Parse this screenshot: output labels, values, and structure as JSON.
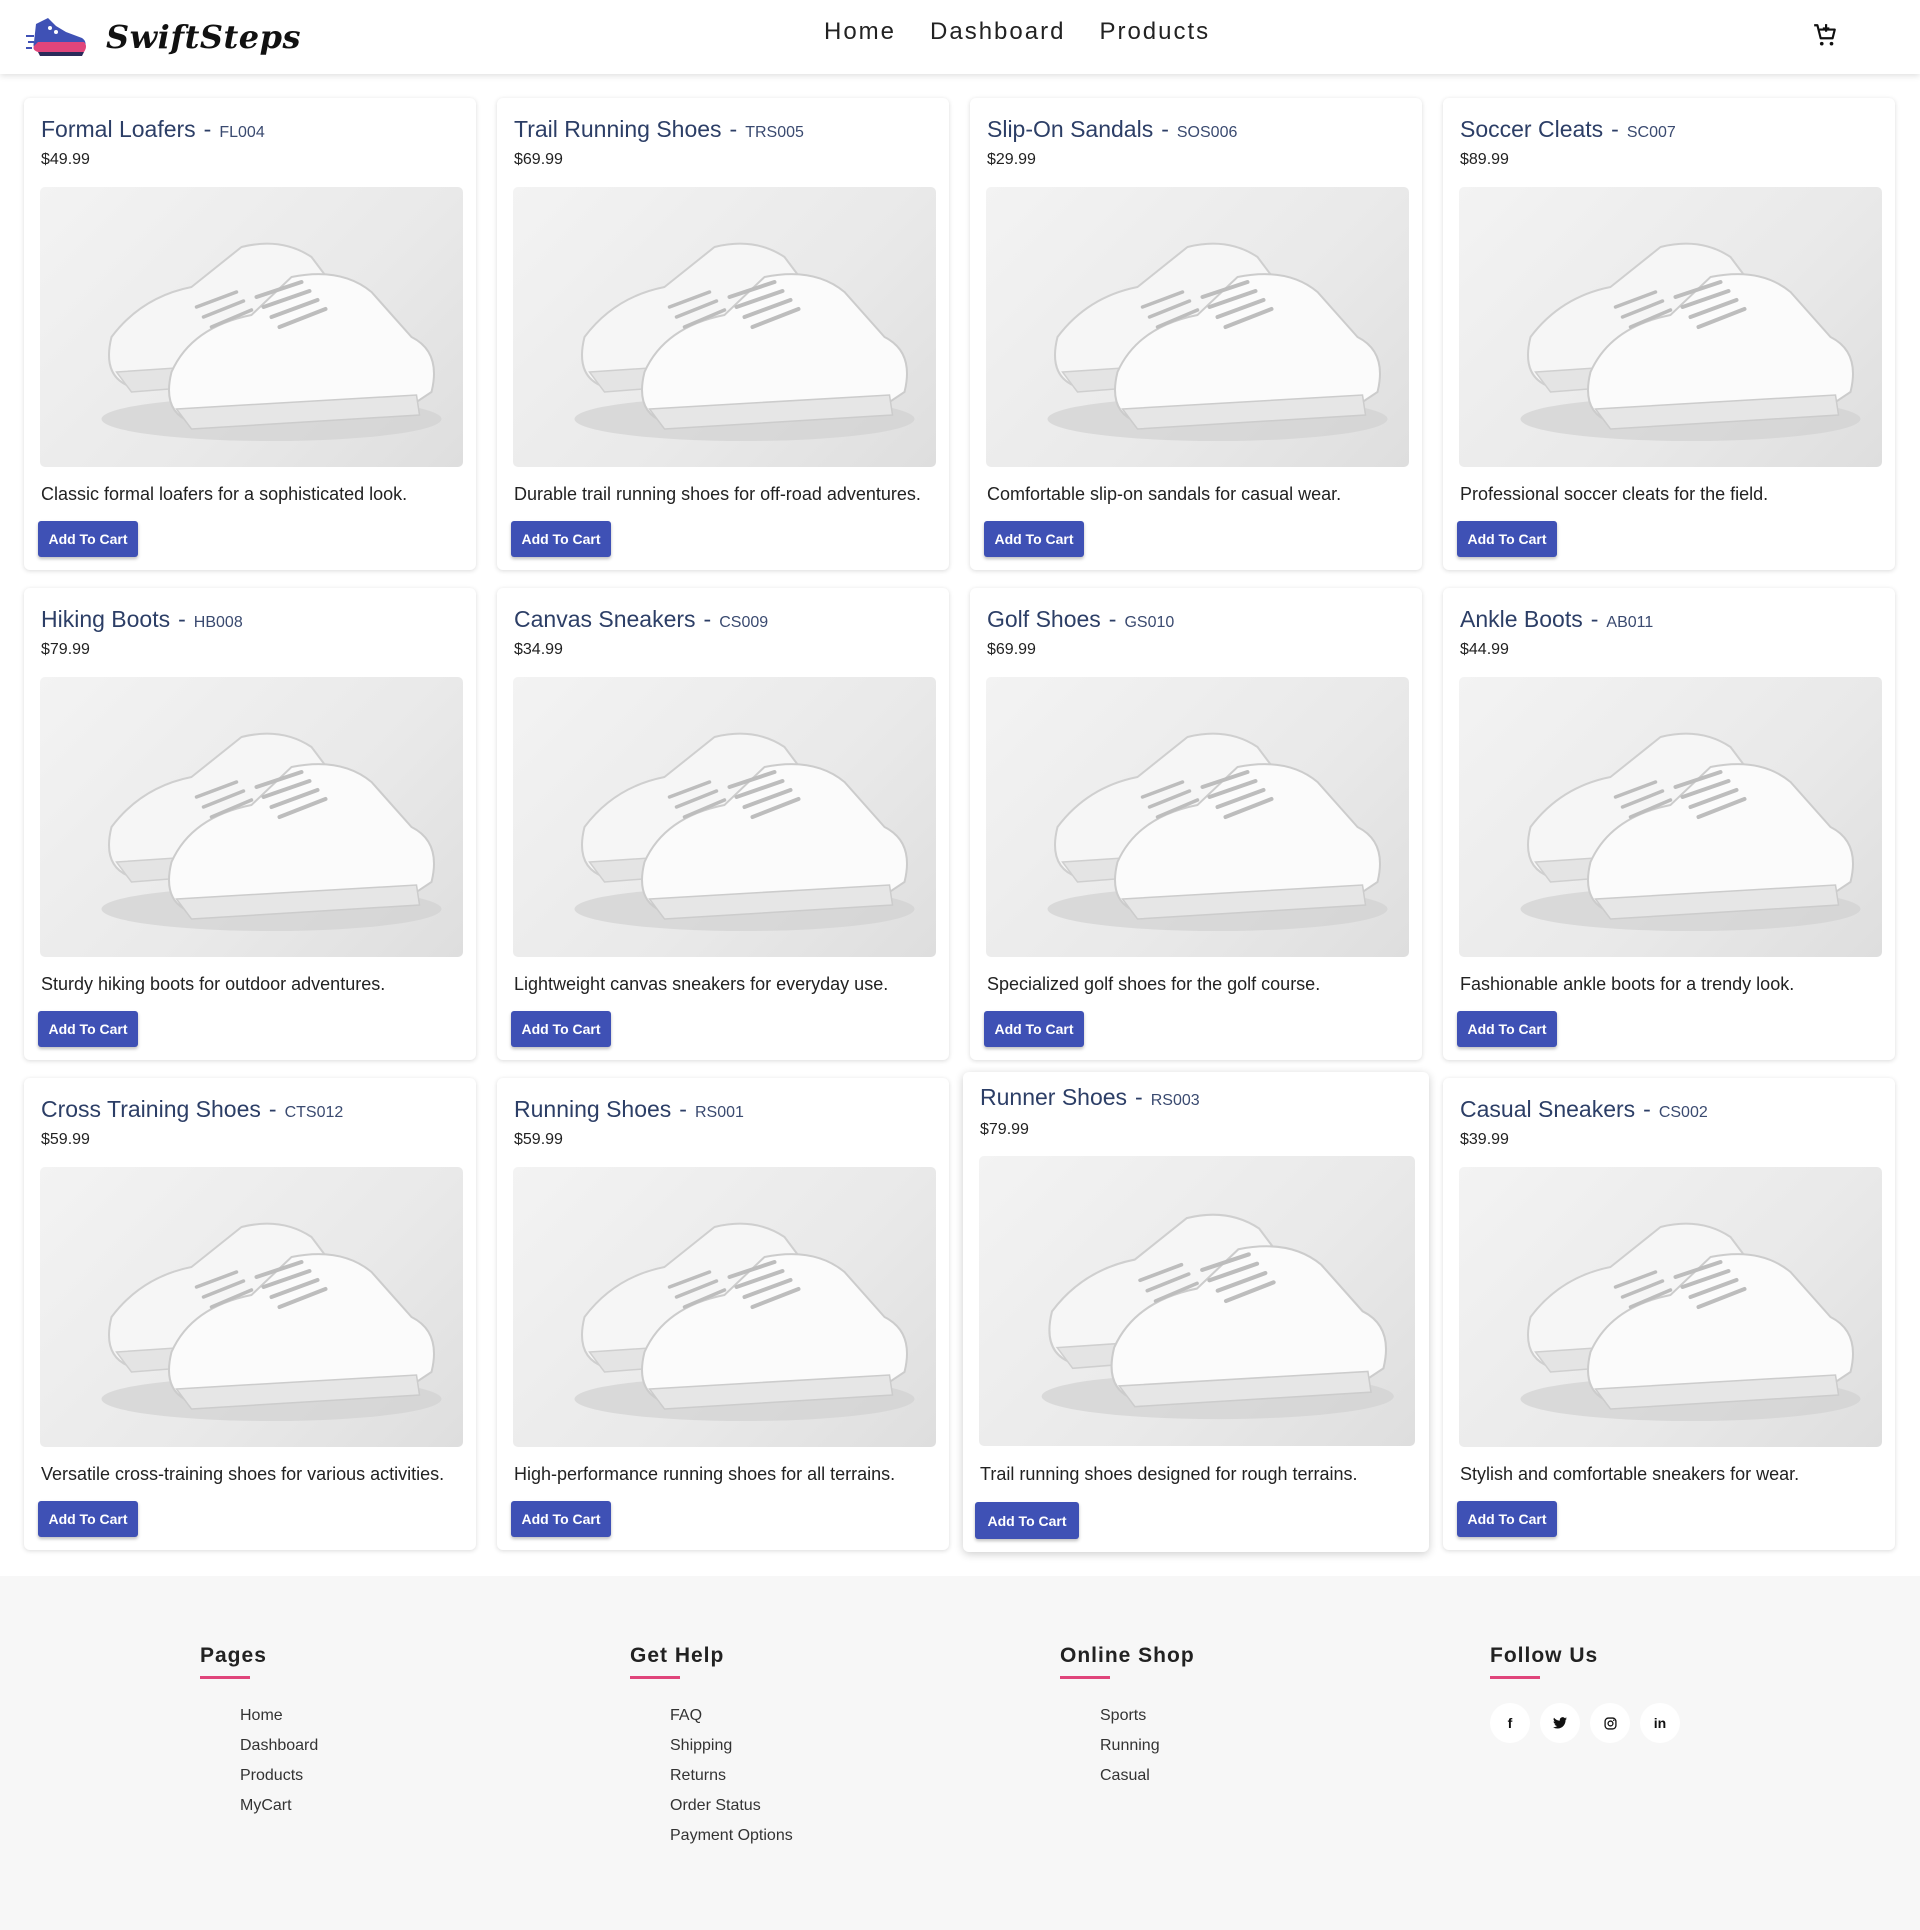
{
  "brand": {
    "name": "SwiftSteps"
  },
  "nav": {
    "home": "Home",
    "dashboard": "Dashboard",
    "products": "Products"
  },
  "colors": {
    "accent": "#3f51b5",
    "footer_underline": "#e0457b",
    "title": "#2c3e66"
  },
  "products": [
    {
      "name": "Formal Loafers",
      "sku": "FL004",
      "price": "$49.99",
      "description": "Classic formal loafers for a sophisticated look.",
      "button": "Add To Cart"
    },
    {
      "name": "Trail Running Shoes",
      "sku": "TRS005",
      "price": "$69.99",
      "description": "Durable trail running shoes for off-road adventures.",
      "button": "Add To Cart"
    },
    {
      "name": "Slip-On Sandals",
      "sku": "SOS006",
      "price": "$29.99",
      "description": "Comfortable slip-on sandals for casual wear.",
      "button": "Add To Cart"
    },
    {
      "name": "Soccer Cleats",
      "sku": "SC007",
      "price": "$89.99",
      "description": "Professional soccer cleats for the field.",
      "button": "Add To Cart"
    },
    {
      "name": "Hiking Boots",
      "sku": "HB008",
      "price": "$79.99",
      "description": "Sturdy hiking boots for outdoor adventures.",
      "button": "Add To Cart"
    },
    {
      "name": "Canvas Sneakers",
      "sku": "CS009",
      "price": "$34.99",
      "description": "Lightweight canvas sneakers for everyday use.",
      "button": "Add To Cart"
    },
    {
      "name": "Golf Shoes",
      "sku": "GS010",
      "price": "$69.99",
      "description": "Specialized golf shoes for the golf course.",
      "button": "Add To Cart"
    },
    {
      "name": "Ankle Boots",
      "sku": "AB011",
      "price": "$44.99",
      "description": "Fashionable ankle boots for a trendy look.",
      "button": "Add To Cart"
    },
    {
      "name": "Cross Training Shoes",
      "sku": "CTS012",
      "price": "$59.99",
      "description": "Versatile cross-training shoes for various activities.",
      "button": "Add To Cart"
    },
    {
      "name": "Running Shoes",
      "sku": "RS001",
      "price": "$59.99",
      "description": "High-performance running shoes for all terrains.",
      "button": "Add To Cart"
    },
    {
      "name": "Runner Shoes",
      "sku": "RS003",
      "price": "$79.99",
      "description": "Trail running shoes designed for rough terrains.",
      "button": "Add To Cart"
    },
    {
      "name": "Casual Sneakers",
      "sku": "CS002",
      "price": "$39.99",
      "description": "Stylish and comfortable sneakers for wear.",
      "button": "Add To Cart"
    }
  ],
  "footer": {
    "pages": {
      "title": "Pages",
      "links": [
        "Home",
        "Dashboard",
        "Products",
        "MyCart"
      ]
    },
    "help": {
      "title": "Get Help",
      "links": [
        "FAQ",
        "Shipping",
        "Returns",
        "Order Status",
        "Payment Options"
      ]
    },
    "shop": {
      "title": "Online Shop",
      "links": [
        "Sports",
        "Running",
        "Casual"
      ]
    },
    "follow": {
      "title": "Follow Us",
      "icons": [
        "facebook-icon",
        "twitter-icon",
        "instagram-icon",
        "linkedin-icon"
      ]
    }
  }
}
